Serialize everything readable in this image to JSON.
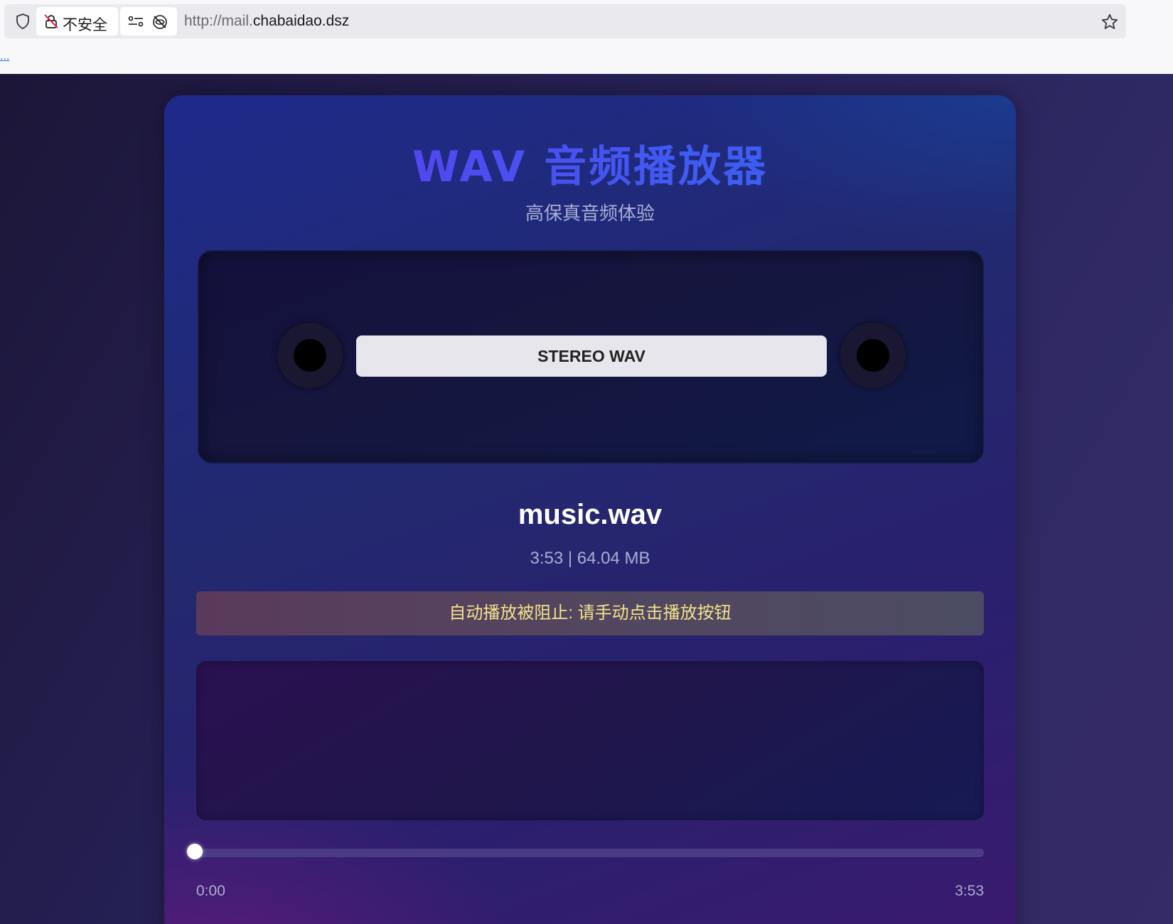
{
  "browser": {
    "security_label": "不安全",
    "url_prefix": "http://mail.",
    "url_domain": "chabaidao.dsz",
    "bookmark_link": "..."
  },
  "player": {
    "title": "WAV 音频播放器",
    "subtitle": "高保真音频体验",
    "cassette_label": "STEREO WAV",
    "track_name": "music.wav",
    "track_meta": "3:53 | 64.04 MB",
    "notice": "自动播放被阻止: 请手动点击播放按钮",
    "time_current": "0:00",
    "time_total": "3:53",
    "progress_fraction": 0
  },
  "colors": {
    "title_gradient_start": "#6a2fe0",
    "title_gradient_end": "#2f6ef5",
    "notice_text": "#f3e48a"
  },
  "icons": [
    "shield-icon",
    "lock-off-icon",
    "permissions-icon",
    "tracking-off-icon",
    "star-icon"
  ]
}
